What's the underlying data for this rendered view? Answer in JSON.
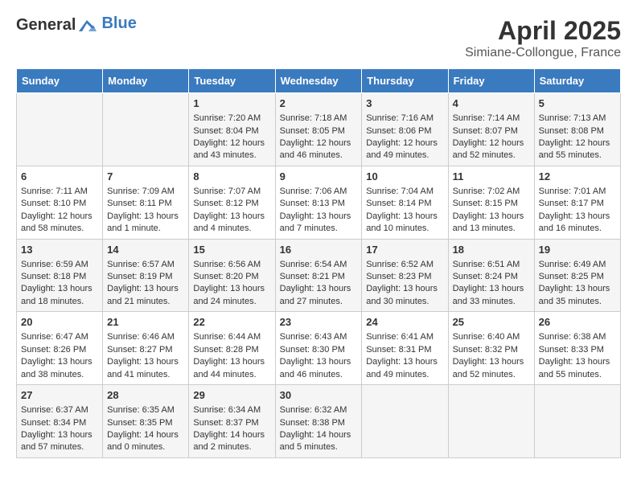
{
  "header": {
    "logo_general": "General",
    "logo_blue": "Blue",
    "month_year": "April 2025",
    "location": "Simiane-Collongue, France"
  },
  "weekdays": [
    "Sunday",
    "Monday",
    "Tuesday",
    "Wednesday",
    "Thursday",
    "Friday",
    "Saturday"
  ],
  "weeks": [
    [
      {
        "day": "",
        "sunrise": "",
        "sunset": "",
        "daylight": ""
      },
      {
        "day": "",
        "sunrise": "",
        "sunset": "",
        "daylight": ""
      },
      {
        "day": "1",
        "sunrise": "Sunrise: 7:20 AM",
        "sunset": "Sunset: 8:04 PM",
        "daylight": "Daylight: 12 hours and 43 minutes."
      },
      {
        "day": "2",
        "sunrise": "Sunrise: 7:18 AM",
        "sunset": "Sunset: 8:05 PM",
        "daylight": "Daylight: 12 hours and 46 minutes."
      },
      {
        "day": "3",
        "sunrise": "Sunrise: 7:16 AM",
        "sunset": "Sunset: 8:06 PM",
        "daylight": "Daylight: 12 hours and 49 minutes."
      },
      {
        "day": "4",
        "sunrise": "Sunrise: 7:14 AM",
        "sunset": "Sunset: 8:07 PM",
        "daylight": "Daylight: 12 hours and 52 minutes."
      },
      {
        "day": "5",
        "sunrise": "Sunrise: 7:13 AM",
        "sunset": "Sunset: 8:08 PM",
        "daylight": "Daylight: 12 hours and 55 minutes."
      }
    ],
    [
      {
        "day": "6",
        "sunrise": "Sunrise: 7:11 AM",
        "sunset": "Sunset: 8:10 PM",
        "daylight": "Daylight: 12 hours and 58 minutes."
      },
      {
        "day": "7",
        "sunrise": "Sunrise: 7:09 AM",
        "sunset": "Sunset: 8:11 PM",
        "daylight": "Daylight: 13 hours and 1 minute."
      },
      {
        "day": "8",
        "sunrise": "Sunrise: 7:07 AM",
        "sunset": "Sunset: 8:12 PM",
        "daylight": "Daylight: 13 hours and 4 minutes."
      },
      {
        "day": "9",
        "sunrise": "Sunrise: 7:06 AM",
        "sunset": "Sunset: 8:13 PM",
        "daylight": "Daylight: 13 hours and 7 minutes."
      },
      {
        "day": "10",
        "sunrise": "Sunrise: 7:04 AM",
        "sunset": "Sunset: 8:14 PM",
        "daylight": "Daylight: 13 hours and 10 minutes."
      },
      {
        "day": "11",
        "sunrise": "Sunrise: 7:02 AM",
        "sunset": "Sunset: 8:15 PM",
        "daylight": "Daylight: 13 hours and 13 minutes."
      },
      {
        "day": "12",
        "sunrise": "Sunrise: 7:01 AM",
        "sunset": "Sunset: 8:17 PM",
        "daylight": "Daylight: 13 hours and 16 minutes."
      }
    ],
    [
      {
        "day": "13",
        "sunrise": "Sunrise: 6:59 AM",
        "sunset": "Sunset: 8:18 PM",
        "daylight": "Daylight: 13 hours and 18 minutes."
      },
      {
        "day": "14",
        "sunrise": "Sunrise: 6:57 AM",
        "sunset": "Sunset: 8:19 PM",
        "daylight": "Daylight: 13 hours and 21 minutes."
      },
      {
        "day": "15",
        "sunrise": "Sunrise: 6:56 AM",
        "sunset": "Sunset: 8:20 PM",
        "daylight": "Daylight: 13 hours and 24 minutes."
      },
      {
        "day": "16",
        "sunrise": "Sunrise: 6:54 AM",
        "sunset": "Sunset: 8:21 PM",
        "daylight": "Daylight: 13 hours and 27 minutes."
      },
      {
        "day": "17",
        "sunrise": "Sunrise: 6:52 AM",
        "sunset": "Sunset: 8:23 PM",
        "daylight": "Daylight: 13 hours and 30 minutes."
      },
      {
        "day": "18",
        "sunrise": "Sunrise: 6:51 AM",
        "sunset": "Sunset: 8:24 PM",
        "daylight": "Daylight: 13 hours and 33 minutes."
      },
      {
        "day": "19",
        "sunrise": "Sunrise: 6:49 AM",
        "sunset": "Sunset: 8:25 PM",
        "daylight": "Daylight: 13 hours and 35 minutes."
      }
    ],
    [
      {
        "day": "20",
        "sunrise": "Sunrise: 6:47 AM",
        "sunset": "Sunset: 8:26 PM",
        "daylight": "Daylight: 13 hours and 38 minutes."
      },
      {
        "day": "21",
        "sunrise": "Sunrise: 6:46 AM",
        "sunset": "Sunset: 8:27 PM",
        "daylight": "Daylight: 13 hours and 41 minutes."
      },
      {
        "day": "22",
        "sunrise": "Sunrise: 6:44 AM",
        "sunset": "Sunset: 8:28 PM",
        "daylight": "Daylight: 13 hours and 44 minutes."
      },
      {
        "day": "23",
        "sunrise": "Sunrise: 6:43 AM",
        "sunset": "Sunset: 8:30 PM",
        "daylight": "Daylight: 13 hours and 46 minutes."
      },
      {
        "day": "24",
        "sunrise": "Sunrise: 6:41 AM",
        "sunset": "Sunset: 8:31 PM",
        "daylight": "Daylight: 13 hours and 49 minutes."
      },
      {
        "day": "25",
        "sunrise": "Sunrise: 6:40 AM",
        "sunset": "Sunset: 8:32 PM",
        "daylight": "Daylight: 13 hours and 52 minutes."
      },
      {
        "day": "26",
        "sunrise": "Sunrise: 6:38 AM",
        "sunset": "Sunset: 8:33 PM",
        "daylight": "Daylight: 13 hours and 55 minutes."
      }
    ],
    [
      {
        "day": "27",
        "sunrise": "Sunrise: 6:37 AM",
        "sunset": "Sunset: 8:34 PM",
        "daylight": "Daylight: 13 hours and 57 minutes."
      },
      {
        "day": "28",
        "sunrise": "Sunrise: 6:35 AM",
        "sunset": "Sunset: 8:35 PM",
        "daylight": "Daylight: 14 hours and 0 minutes."
      },
      {
        "day": "29",
        "sunrise": "Sunrise: 6:34 AM",
        "sunset": "Sunset: 8:37 PM",
        "daylight": "Daylight: 14 hours and 2 minutes."
      },
      {
        "day": "30",
        "sunrise": "Sunrise: 6:32 AM",
        "sunset": "Sunset: 8:38 PM",
        "daylight": "Daylight: 14 hours and 5 minutes."
      },
      {
        "day": "",
        "sunrise": "",
        "sunset": "",
        "daylight": ""
      },
      {
        "day": "",
        "sunrise": "",
        "sunset": "",
        "daylight": ""
      },
      {
        "day": "",
        "sunrise": "",
        "sunset": "",
        "daylight": ""
      }
    ]
  ]
}
